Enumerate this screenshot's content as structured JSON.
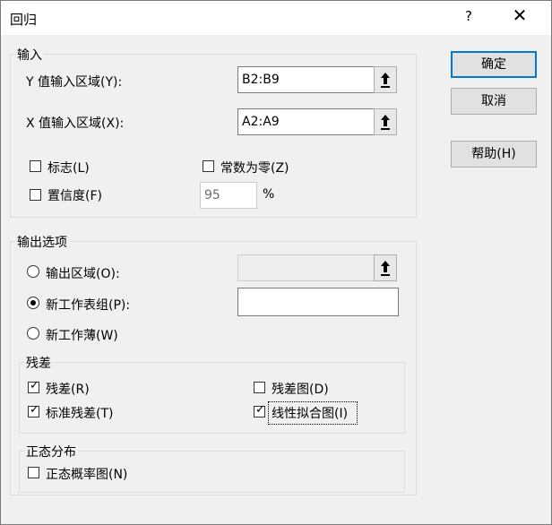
{
  "window": {
    "title": "回归",
    "help_label": "?",
    "close_label": "✕"
  },
  "input": {
    "legend": "输入",
    "y_range_label": "Y 值输入区域(Y):",
    "y_range_value": "B2:B9",
    "x_range_label": "X 值输入区域(X):",
    "x_range_value": "A2:A9",
    "labels_label": "标志(L)",
    "labels_checked": false,
    "constant_zero_label": "常数为零(Z)",
    "constant_zero_checked": false,
    "confidence_label": "置信度(F)",
    "confidence_checked": false,
    "confidence_value": "95",
    "confidence_unit": "%"
  },
  "output": {
    "legend": "输出选项",
    "output_range_label": "输出区域(O):",
    "output_range_value": "",
    "new_sheet_label": "新工作表组(P):",
    "new_sheet_value": "",
    "new_workbook_label": "新工作薄(W)",
    "selected": "new_sheet"
  },
  "residuals": {
    "legend": "残差",
    "residuals_label": "残差(R)",
    "residuals_checked": true,
    "residual_plots_label": "残差图(D)",
    "residual_plots_checked": false,
    "standard_residuals_label": "标准残差(T)",
    "standard_residuals_checked": true,
    "line_fit_label": "线性拟合图(I)",
    "line_fit_checked": true
  },
  "normal": {
    "legend": "正态分布",
    "probability_plots_label": "正态概率图(N)",
    "probability_plots_checked": false
  },
  "buttons": {
    "ok": "确定",
    "cancel": "取消",
    "help": "帮助(H)"
  },
  "icons": {
    "range_selector": "collapse-dialog-arrow-icon",
    "check": "✓"
  }
}
